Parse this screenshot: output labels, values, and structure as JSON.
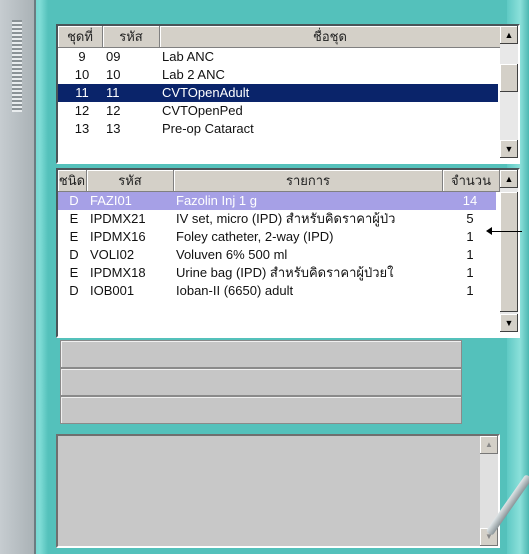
{
  "grid_sets": {
    "headers": [
      "ชุดที่",
      "รหัส",
      "ชื่อชุด"
    ],
    "rows": [
      [
        "9",
        "09",
        "Lab ANC"
      ],
      [
        "10",
        "10",
        "Lab 2 ANC"
      ],
      [
        "11",
        "11",
        "CVTOpenAdult"
      ],
      [
        "12",
        "12",
        "CVTOpenPed"
      ],
      [
        "13",
        "13",
        "Pre-op Cataract"
      ]
    ],
    "selected_index": 2
  },
  "grid_items": {
    "headers": [
      "ชนิด",
      "รหัส",
      "รายการ",
      "จำนวน"
    ],
    "rows": [
      [
        "D",
        "FAZI01",
        "Fazolin Inj 1 g",
        "14"
      ],
      [
        "E",
        "IPDMX21",
        "IV set, micro (IPD) สำหรับคิดราคาผู้ป่ว",
        "5"
      ],
      [
        "E",
        "IPDMX16",
        "Foley catheter, 2-way (IPD)",
        "1"
      ],
      [
        "D",
        "VOLI02",
        "Voluven 6% 500 ml",
        "1"
      ],
      [
        "E",
        "IPDMX18",
        "Urine bag (IPD) สำหรับคิดราคาผู้ป่วยใ",
        "1"
      ],
      [
        "D",
        "IOB001",
        "Ioban-II (6650) adult",
        "1"
      ]
    ],
    "selected_index": 0
  },
  "scroll": {
    "up_glyph": "▲",
    "down_glyph": "▼"
  },
  "colors": {
    "frame_teal": "#5dc6c0",
    "selection_navy": "#0a246a",
    "selection_lavender": "#a6a0e6"
  }
}
